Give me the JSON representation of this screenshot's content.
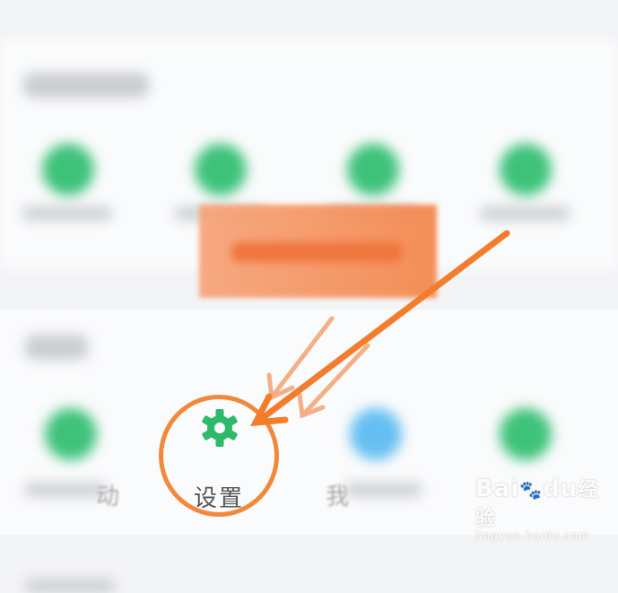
{
  "settings": {
    "label": "设置"
  },
  "partial_labels": {
    "left": "动",
    "right": "我"
  },
  "watermark": {
    "brand": "Bai",
    "brand_suffix": "du",
    "product": "经验",
    "url": "jingyan.baidu.com"
  },
  "icons": [
    "gear-icon"
  ],
  "colors": {
    "accent_orange": "#f3883a",
    "app_green": "#3ec27a",
    "app_blue": "#66bff2"
  }
}
